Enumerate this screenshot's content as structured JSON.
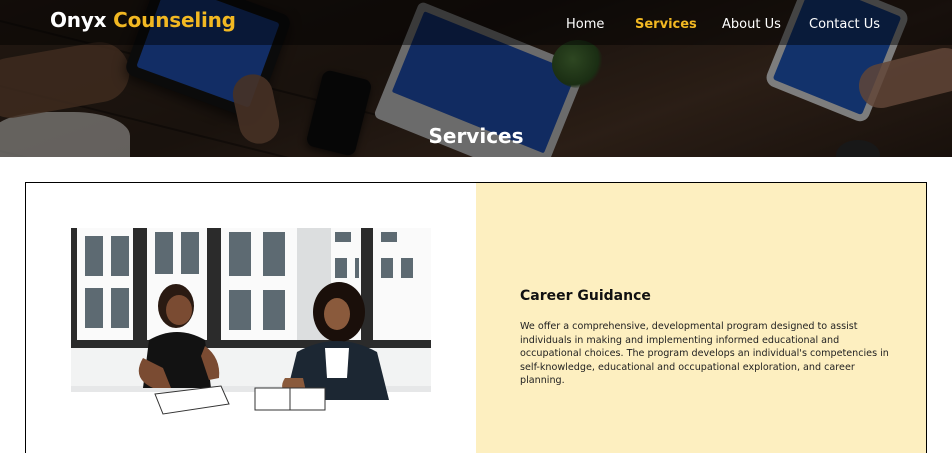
{
  "header": {
    "brand_part1": "Onyx",
    "brand_part2": "Counseling",
    "nav": [
      {
        "label": "Home",
        "active": false
      },
      {
        "label": "Services",
        "active": true
      },
      {
        "label": "About Us",
        "active": false
      },
      {
        "label": "Contact Us",
        "active": false
      }
    ],
    "accent_color": "#f2b822"
  },
  "hero": {
    "title": "Services"
  },
  "service": {
    "title": "Career Guidance",
    "description": "We offer a comprehensive, developmental program designed to assist individuals in making and implementing informed educational and occupational choices. The program develops an individual's competencies in self-knowledge, educational and occupational exploration, and career planning.",
    "panel_color": "#fdefc0"
  }
}
